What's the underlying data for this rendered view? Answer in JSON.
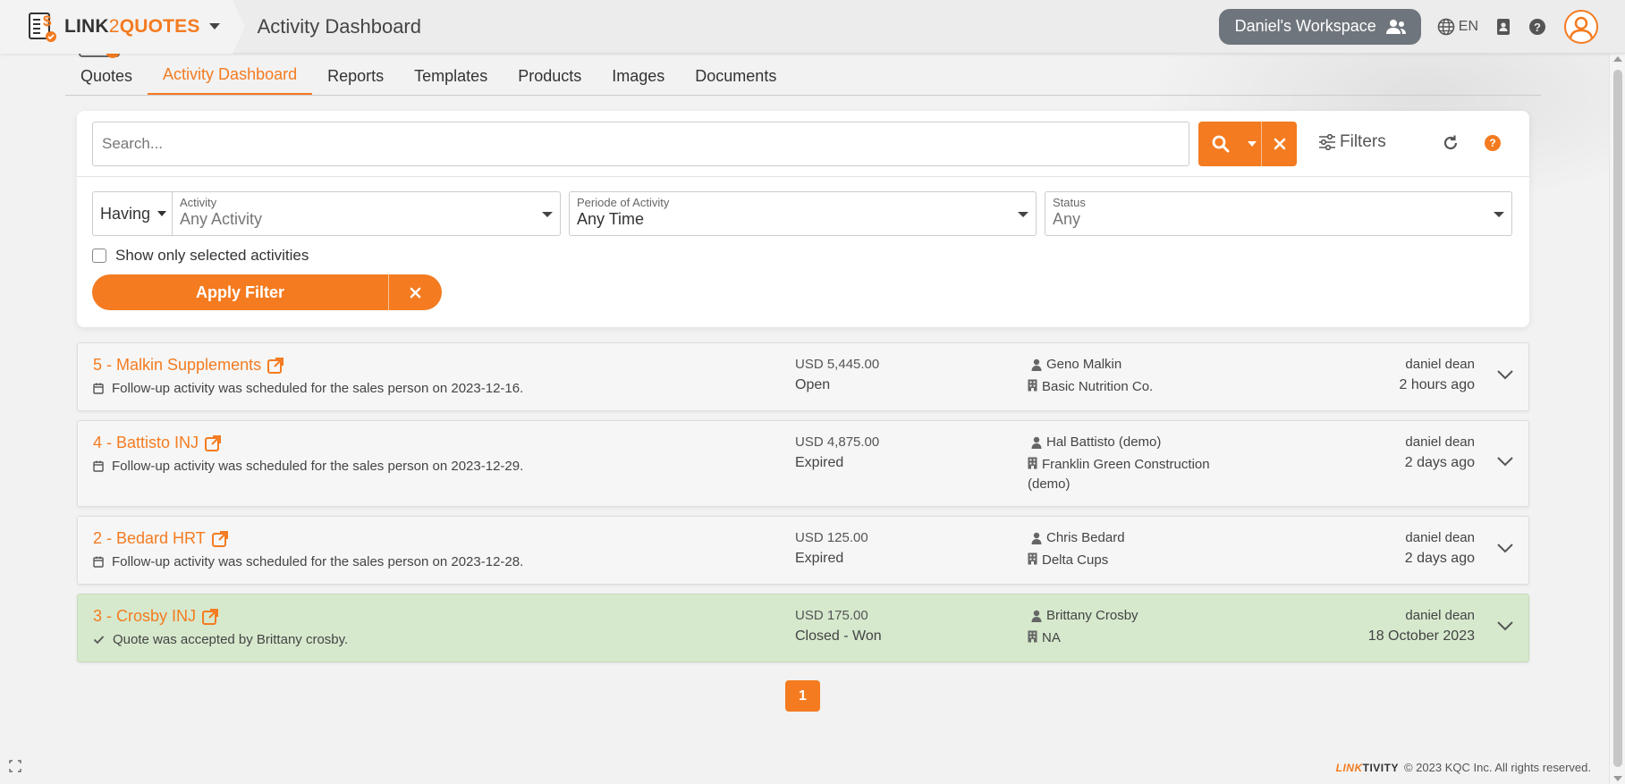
{
  "colors": {
    "accent": "#f47b20",
    "won_bg": "#d6e9cd",
    "workspace_bg": "#6e757c"
  },
  "header": {
    "brand_prefix": "LINK",
    "brand_two": "2",
    "brand_suffix": "QUOTES",
    "page_title": "Activity Dashboard",
    "workspace_label": "Daniel's Workspace",
    "language": "EN",
    "icons": [
      "globe-icon",
      "contact-book-icon",
      "help-icon",
      "user-avatar-icon"
    ]
  },
  "tabs": [
    {
      "label": "Quotes",
      "active": false
    },
    {
      "label": "Activity Dashboard",
      "active": true
    },
    {
      "label": "Reports",
      "active": false
    },
    {
      "label": "Templates",
      "active": false
    },
    {
      "label": "Products",
      "active": false
    },
    {
      "label": "Images",
      "active": false
    },
    {
      "label": "Documents",
      "active": false
    }
  ],
  "search": {
    "placeholder": "Search...",
    "value": "",
    "filters_label": "Filters"
  },
  "filters": {
    "having": "Having",
    "activity": {
      "label": "Activity",
      "value": "Any Activity"
    },
    "period": {
      "label": "Periode of Activity",
      "value": "Any Time"
    },
    "status": {
      "label": "Status",
      "value": "Any"
    },
    "show_selected_label": "Show only selected activities",
    "show_selected_checked": false,
    "apply_label": "Apply Filter"
  },
  "quotes": [
    {
      "title": "5 - Malkin Supplements",
      "description": "Follow-up activity was scheduled for the sales person on 2023-12-16.",
      "desc_icon": "calendar-icon",
      "amount": "USD 5,445.00",
      "status": "Open",
      "contact": "Geno Malkin",
      "company": "Basic Nutrition Co.",
      "user": "daniel dean",
      "time": "2 hours ago"
    },
    {
      "title": "4 - Battisto INJ",
      "description": "Follow-up activity was scheduled for the sales person on 2023-12-29.",
      "desc_icon": "calendar-icon",
      "amount": "USD 4,875.00",
      "status": "Expired",
      "contact": "Hal Battisto (demo)",
      "company": "Franklin Green Construction (demo)",
      "user": "daniel dean",
      "time": "2 days ago"
    },
    {
      "title": "2 - Bedard HRT",
      "description": "Follow-up activity was scheduled for the sales person on 2023-12-28.",
      "desc_icon": "calendar-icon",
      "amount": "USD 125.00",
      "status": "Expired",
      "contact": "Chris Bedard",
      "company": "Delta Cups",
      "user": "daniel dean",
      "time": "2 days ago"
    },
    {
      "title": "3 - Crosby INJ",
      "description": "Quote was accepted by Brittany crosby.",
      "desc_icon": "checkmark-icon",
      "amount": "USD 175.00",
      "status": "Closed - Won",
      "contact": "Brittany Crosby",
      "company": "NA",
      "user": "daniel dean",
      "time": "18 October 2023"
    }
  ],
  "pagination": {
    "current_page": "1"
  },
  "footer": {
    "logo_left": "LINK",
    "logo_right": "TIVITY",
    "copyright": "© 2023 KQC Inc. All rights reserved."
  }
}
